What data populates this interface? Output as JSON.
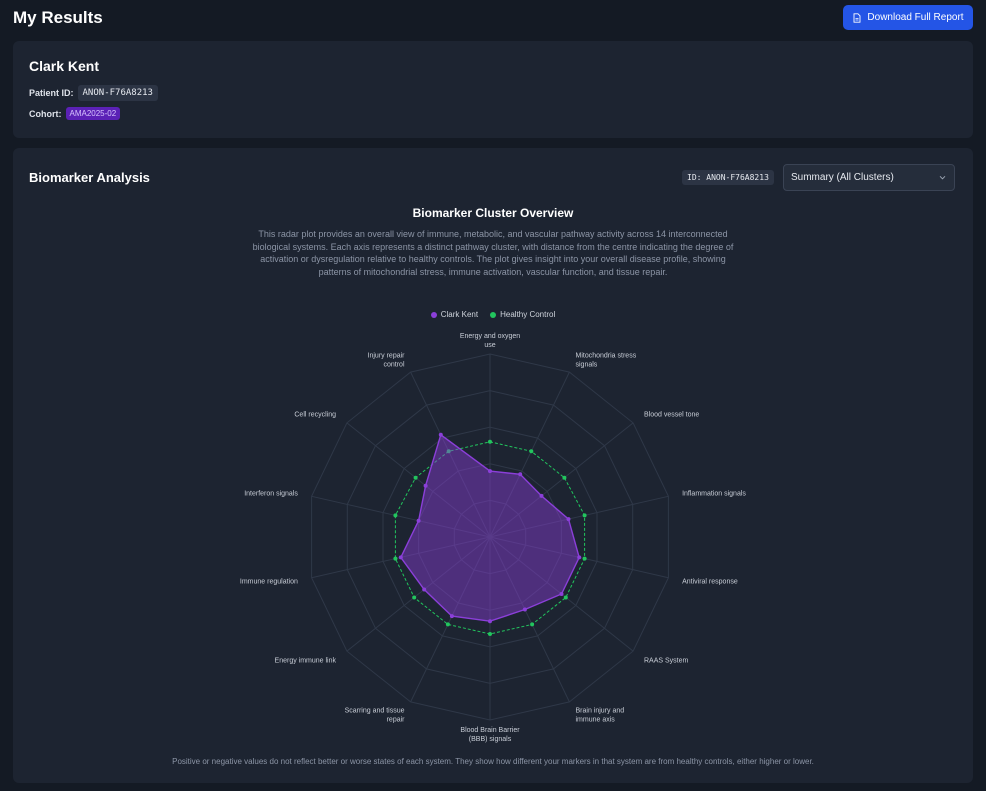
{
  "header": {
    "title": "My Results",
    "download_label": "Download Full Report"
  },
  "patient": {
    "name": "Clark Kent",
    "id_label": "Patient ID:",
    "id_value": "ANON-F76A8213",
    "cohort_label": "Cohort:",
    "cohort_value": "AMA2025-02"
  },
  "analysis": {
    "title": "Biomarker Analysis",
    "id_badge": "ID: ANON-F76A8213",
    "select_value": "Summary (All Clusters)",
    "footnote": "Positive or negative values do not reflect better or worse states of each system. They show how different your markers in that system are from healthy controls, either higher or lower."
  },
  "chart_data": {
    "type": "radar",
    "title": "Biomarker Cluster Overview",
    "description": "This radar plot provides an overall view of immune, metabolic, and vascular pathway activity across 14 interconnected biological systems. Each axis represents a distinct pathway cluster, with distance from the centre indicating the degree of activation or dysregulation relative to healthy controls. The plot gives insight into your overall disease profile, showing patterns of mitochondrial stress, immune activation, vascular function, and tissue repair.",
    "axes": [
      [
        "Energy and oxygen",
        "use"
      ],
      [
        "Mitochondria stress",
        "signals"
      ],
      [
        "Blood vessel tone"
      ],
      [
        "Inflammation signals"
      ],
      [
        "Antiviral response"
      ],
      [
        "RAAS System"
      ],
      [
        "Brain injury and",
        "immune axis"
      ],
      [
        "Blood Brain Barrier",
        "(BBB) signals"
      ],
      [
        "Scarring and tissue",
        "repair"
      ],
      [
        "Energy immune link"
      ],
      [
        "Immune regulation"
      ],
      [
        "Interferon signals"
      ],
      [
        "Cell recycling"
      ],
      [
        "Injury repair",
        "control"
      ]
    ],
    "series": [
      {
        "name": "Clark Kent",
        "color": "#8b3fd9",
        "values": [
          0.36,
          0.38,
          0.36,
          0.44,
          0.5,
          0.5,
          0.44,
          0.46,
          0.48,
          0.46,
          0.5,
          0.4,
          0.45,
          0.62
        ]
      },
      {
        "name": "Healthy Control",
        "color": "#22c55e",
        "values": [
          0.52,
          0.52,
          0.52,
          0.53,
          0.53,
          0.53,
          0.53,
          0.53,
          0.53,
          0.53,
          0.53,
          0.53,
          0.52,
          0.52
        ]
      }
    ],
    "rlim": [
      0,
      1
    ],
    "rings": 5,
    "grid": true,
    "legend_position": "top-center"
  }
}
